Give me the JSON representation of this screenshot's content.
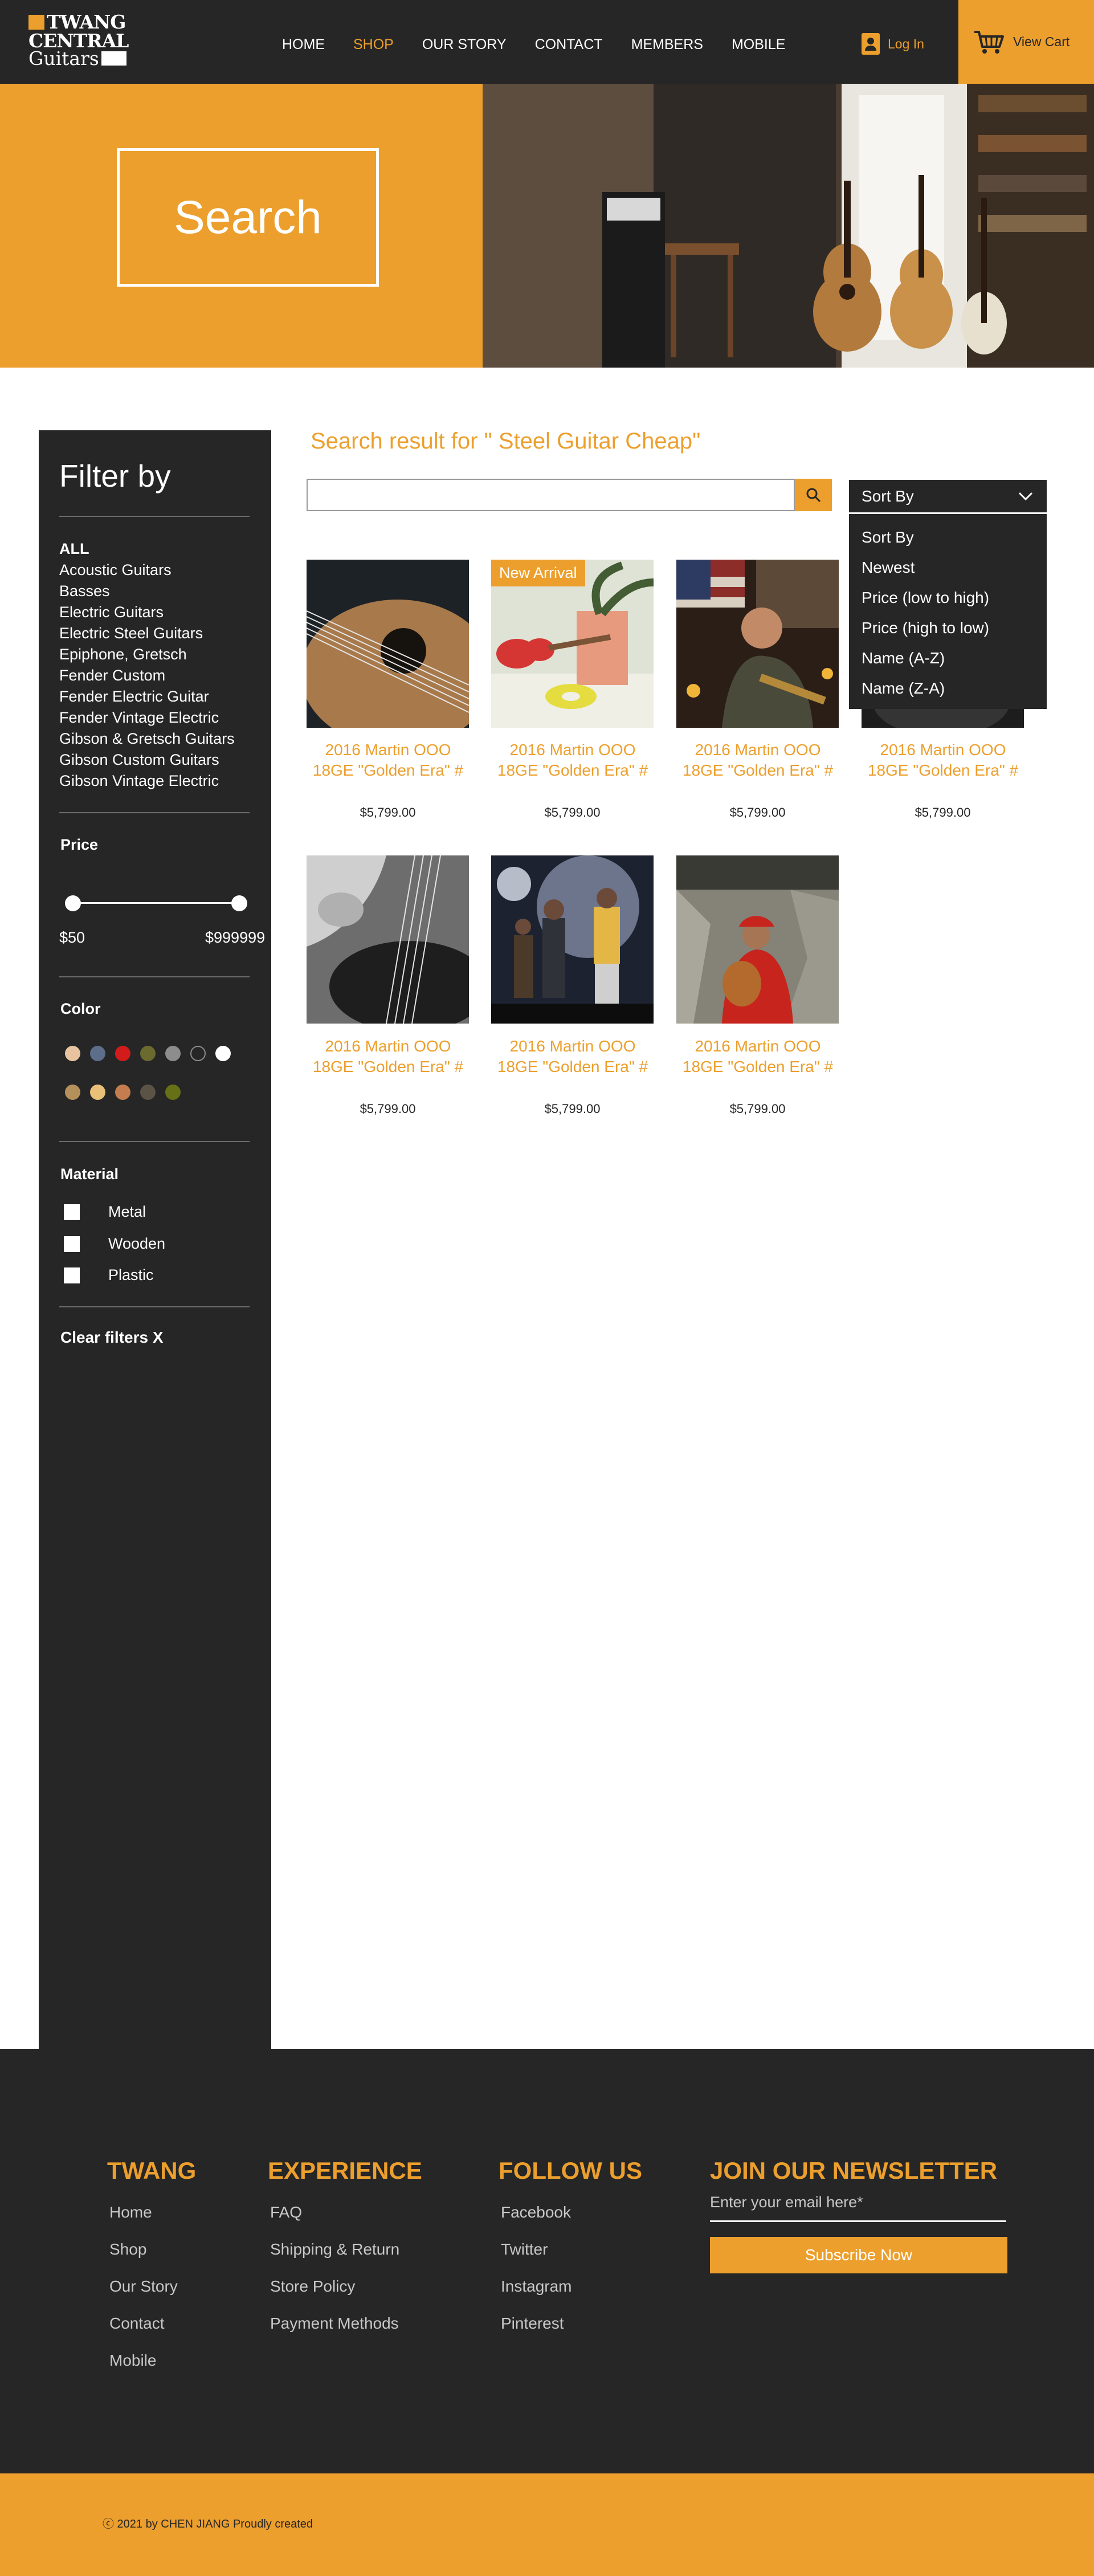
{
  "header": {
    "logo": {
      "line1": "TWANG",
      "line2": "CENTRAL",
      "line3": "Guitars"
    },
    "nav": [
      {
        "label": "HOME",
        "active": false
      },
      {
        "label": "SHOP",
        "active": true
      },
      {
        "label": "OUR STORY",
        "active": false
      },
      {
        "label": "CONTACT",
        "active": false
      },
      {
        "label": "MEMBERS",
        "active": false
      },
      {
        "label": "MOBILE",
        "active": false
      }
    ],
    "login_label": "Log In",
    "cart_label": "View Cart"
  },
  "hero": {
    "title": "Search"
  },
  "sidebar": {
    "title": "Filter by",
    "categories": [
      "ALL",
      "Acoustic Guitars",
      "Basses",
      "Electric Guitars",
      "Electric Steel Guitars",
      "Epiphone, Gretsch",
      "Fender Custom",
      "Fender Electric Guitar",
      "Fender Vintage Electric",
      "Gibson & Gretsch Guitars",
      "Gibson Custom Guitars",
      "Gibson Vintage Electric"
    ],
    "price_heading": "Price",
    "price_min": "$50",
    "price_max": "$999999",
    "color_heading": "Color",
    "colors": [
      "#e8c3a0",
      "#5c6e89",
      "#d21c1c",
      "#6b6b2f",
      "#8d8d8d",
      "#262626",
      "#ffffff",
      "#b4905a",
      "#e8c078",
      "#c47d4e",
      "#5a5346",
      "#667016"
    ],
    "material_heading": "Material",
    "materials": [
      "Metal",
      "Wooden",
      "Plastic"
    ],
    "clear_label": "Clear filters X"
  },
  "main": {
    "result_title": "Search result for \" Steel Guitar Cheap\"",
    "search_value": "",
    "sort": {
      "label": "Sort By",
      "options": [
        "Sort By",
        "Newest",
        "Price (low to high)",
        "Price (high to low)",
        "Name (A-Z)",
        "Name (Z-A)"
      ]
    },
    "products": [
      {
        "name": "2016 Martin OOO 18GE \"Golden Era\" #",
        "price": "$5,799.00",
        "badge": "",
        "image": "guitar-closeup"
      },
      {
        "name": "2016 Martin OOO 18GE \"Golden Era\" #",
        "price": "$5,799.00",
        "badge": "New Arrival",
        "image": "ukulele"
      },
      {
        "name": "2016 Martin OOO 18GE \"Golden Era\" #",
        "price": "$5,799.00",
        "badge": "",
        "image": "performer-flag"
      },
      {
        "name": "2016 Martin OOO 18GE \"Golden Era\" #",
        "price": "$5,799.00",
        "badge": "",
        "image": "dark-guitar"
      },
      {
        "name": "2016 Martin OOO 18GE \"Golden Era\" #",
        "price": "$5,799.00",
        "badge": "",
        "image": "bass-player"
      },
      {
        "name": "2016 Martin OOO 18GE \"Golden Era\" #",
        "price": "$5,799.00",
        "badge": "",
        "image": "concert"
      },
      {
        "name": "2016 Martin OOO 18GE \"Golden Era\" #",
        "price": "$5,799.00",
        "badge": "",
        "image": "lute-player"
      }
    ]
  },
  "footer": {
    "columns": [
      {
        "heading": "TWANG",
        "links": [
          "Home",
          "Shop",
          "Our Story",
          "Contact",
          "Mobile"
        ]
      },
      {
        "heading": "EXPERIENCE",
        "links": [
          "FAQ",
          "Shipping & Return",
          "Store Policy",
          "Payment Methods"
        ]
      },
      {
        "heading": "FOLLOW US",
        "links": [
          "Facebook",
          "Twitter",
          "Instagram",
          "Pinterest"
        ]
      }
    ],
    "newsletter": {
      "heading": "JOIN OUR NEWSLETTER",
      "placeholder": "Enter your email here*",
      "button": "Subscribe Now"
    },
    "copyright": "ⓒ 2021 by CHEN JIANG Proudly created"
  },
  "colors": {
    "accent": "#ec9f2d",
    "dark": "#262626"
  }
}
